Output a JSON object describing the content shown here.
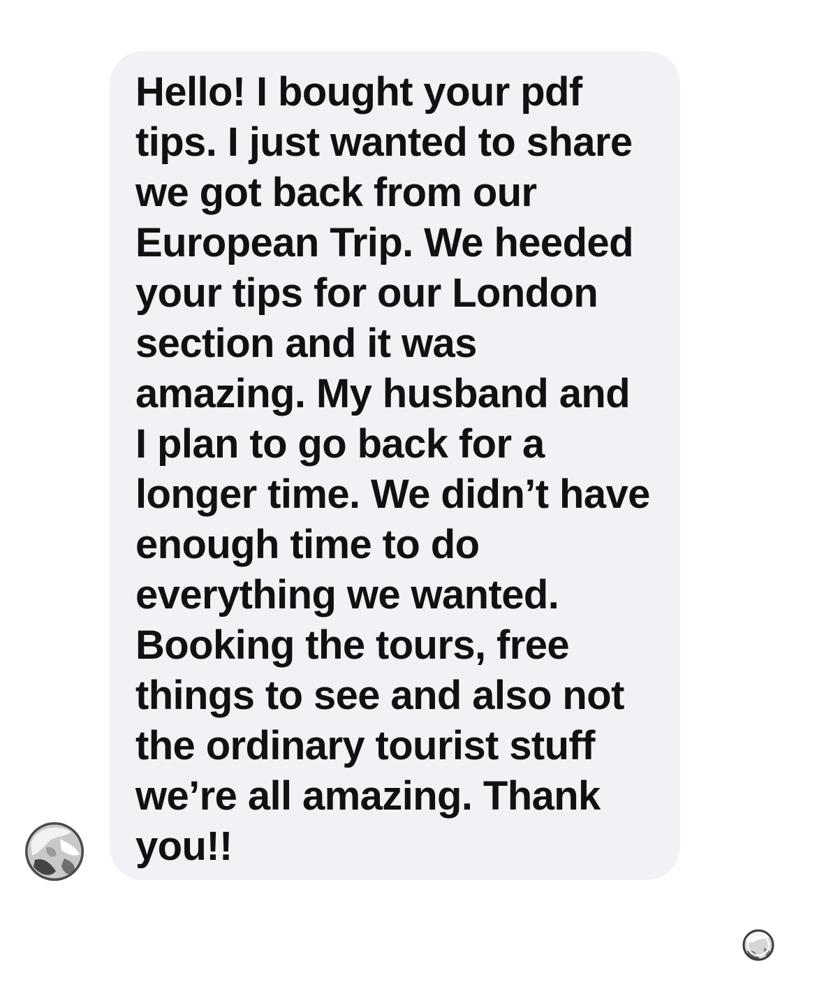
{
  "conversation": {
    "incoming_message": {
      "lines": [
        "Hello! I bought your pdf",
        "tips. I just wanted to share",
        "we got back from our",
        "European Trip. We heeded",
        "your tips for our London",
        "section and it was",
        "amazing. My husband and",
        "I plan to go back for a",
        "longer time. We didn’t have",
        "enough time to do",
        "everything we wanted.",
        "Booking the tours, free",
        "things to see and also not",
        "the ordinary tourist stuff",
        "we’re all amazing. Thank",
        "you!!"
      ]
    },
    "sender_avatar": "sender-avatar-photo",
    "read_receipt_icon": "read-receipt-avatar-icon"
  },
  "colors": {
    "page_background": "#ffffff",
    "bubble_background": "#f1f2f6",
    "message_text": "#111111"
  }
}
